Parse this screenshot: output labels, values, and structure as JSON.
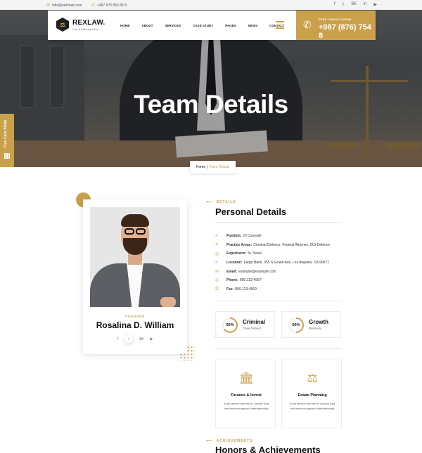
{
  "topbar": {
    "email": "info@webmail.com",
    "phone": "+987 975 865 86 8",
    "social": [
      "f",
      "𝕥",
      "Bē",
      "in",
      "▶"
    ]
  },
  "header": {
    "logo_name": "REXLAW.",
    "logo_tagline": "Law & Attorney Firm",
    "nav": [
      "HOME",
      "ABOUT",
      "SERVICES",
      "CASE STUDY",
      "PAGES",
      "NEWS",
      "CONTACT"
    ],
    "consult_label": "FREE CONSULTATION",
    "consult_phone": "+987 (876) 754 8"
  },
  "side_tab": {
    "label": "Free Case Study"
  },
  "hero": {
    "title": "Team Details"
  },
  "breadcrumb": {
    "home": "Home",
    "separator": "|",
    "current": "Team Details"
  },
  "profile": {
    "role": "FOUNDER",
    "name": "Rosalina D. William",
    "social": [
      "f",
      "𝕥",
      "Bē",
      "▶"
    ]
  },
  "details": {
    "eyebrow": "DETAILS",
    "heading": "Personal Details",
    "rows": [
      {
        "icon": "bookmark-icon",
        "glyph": "⟡",
        "label": "Position:",
        "value": "Of Counsell"
      },
      {
        "icon": "edit-icon",
        "glyph": "✎",
        "label": "Practice Areas:",
        "value": "Criminal Defence, Federal Attorney, DUI Defence"
      },
      {
        "icon": "target-icon",
        "glyph": "◎",
        "label": "Experience:",
        "value": "5+ Years"
      },
      {
        "icon": "location-icon",
        "glyph": "⌖",
        "label": "Location:",
        "value": "Fargo Bank, 355 S Grand Ave, Los Angeles, CA 90071"
      },
      {
        "icon": "mail-icon",
        "glyph": "✉",
        "label": "Email:",
        "value": "example@example.com"
      },
      {
        "icon": "phone-icon",
        "glyph": "✆",
        "label": "Phone:",
        "value": "800.123.4567"
      },
      {
        "icon": "fax-icon",
        "glyph": "⎙",
        "label": "Fax:",
        "value": "800.123.4569"
      }
    ]
  },
  "stats": [
    {
      "percent_label": "65%",
      "percent": 65,
      "title": "Criminal",
      "subtitle": "Case Solved"
    },
    {
      "percent_label": "50%",
      "percent": 50,
      "title": "Growth",
      "subtitle": "Business"
    }
  ],
  "services": [
    {
      "icon": "bank-icon",
      "glyph": "🏛",
      "title": "Finance & Invest",
      "desc": "A full service law firm in London that has been recognised internationally"
    },
    {
      "icon": "gavel-icon",
      "glyph": "⚖",
      "title": "Estate Planning",
      "desc": "A full service law firm in London that has been recognised internationally"
    }
  ],
  "achievements": {
    "eyebrow": "ACHIEVEMENTS",
    "heading": "Honors & Achievements"
  },
  "colors": {
    "accent": "#c9a14a"
  }
}
